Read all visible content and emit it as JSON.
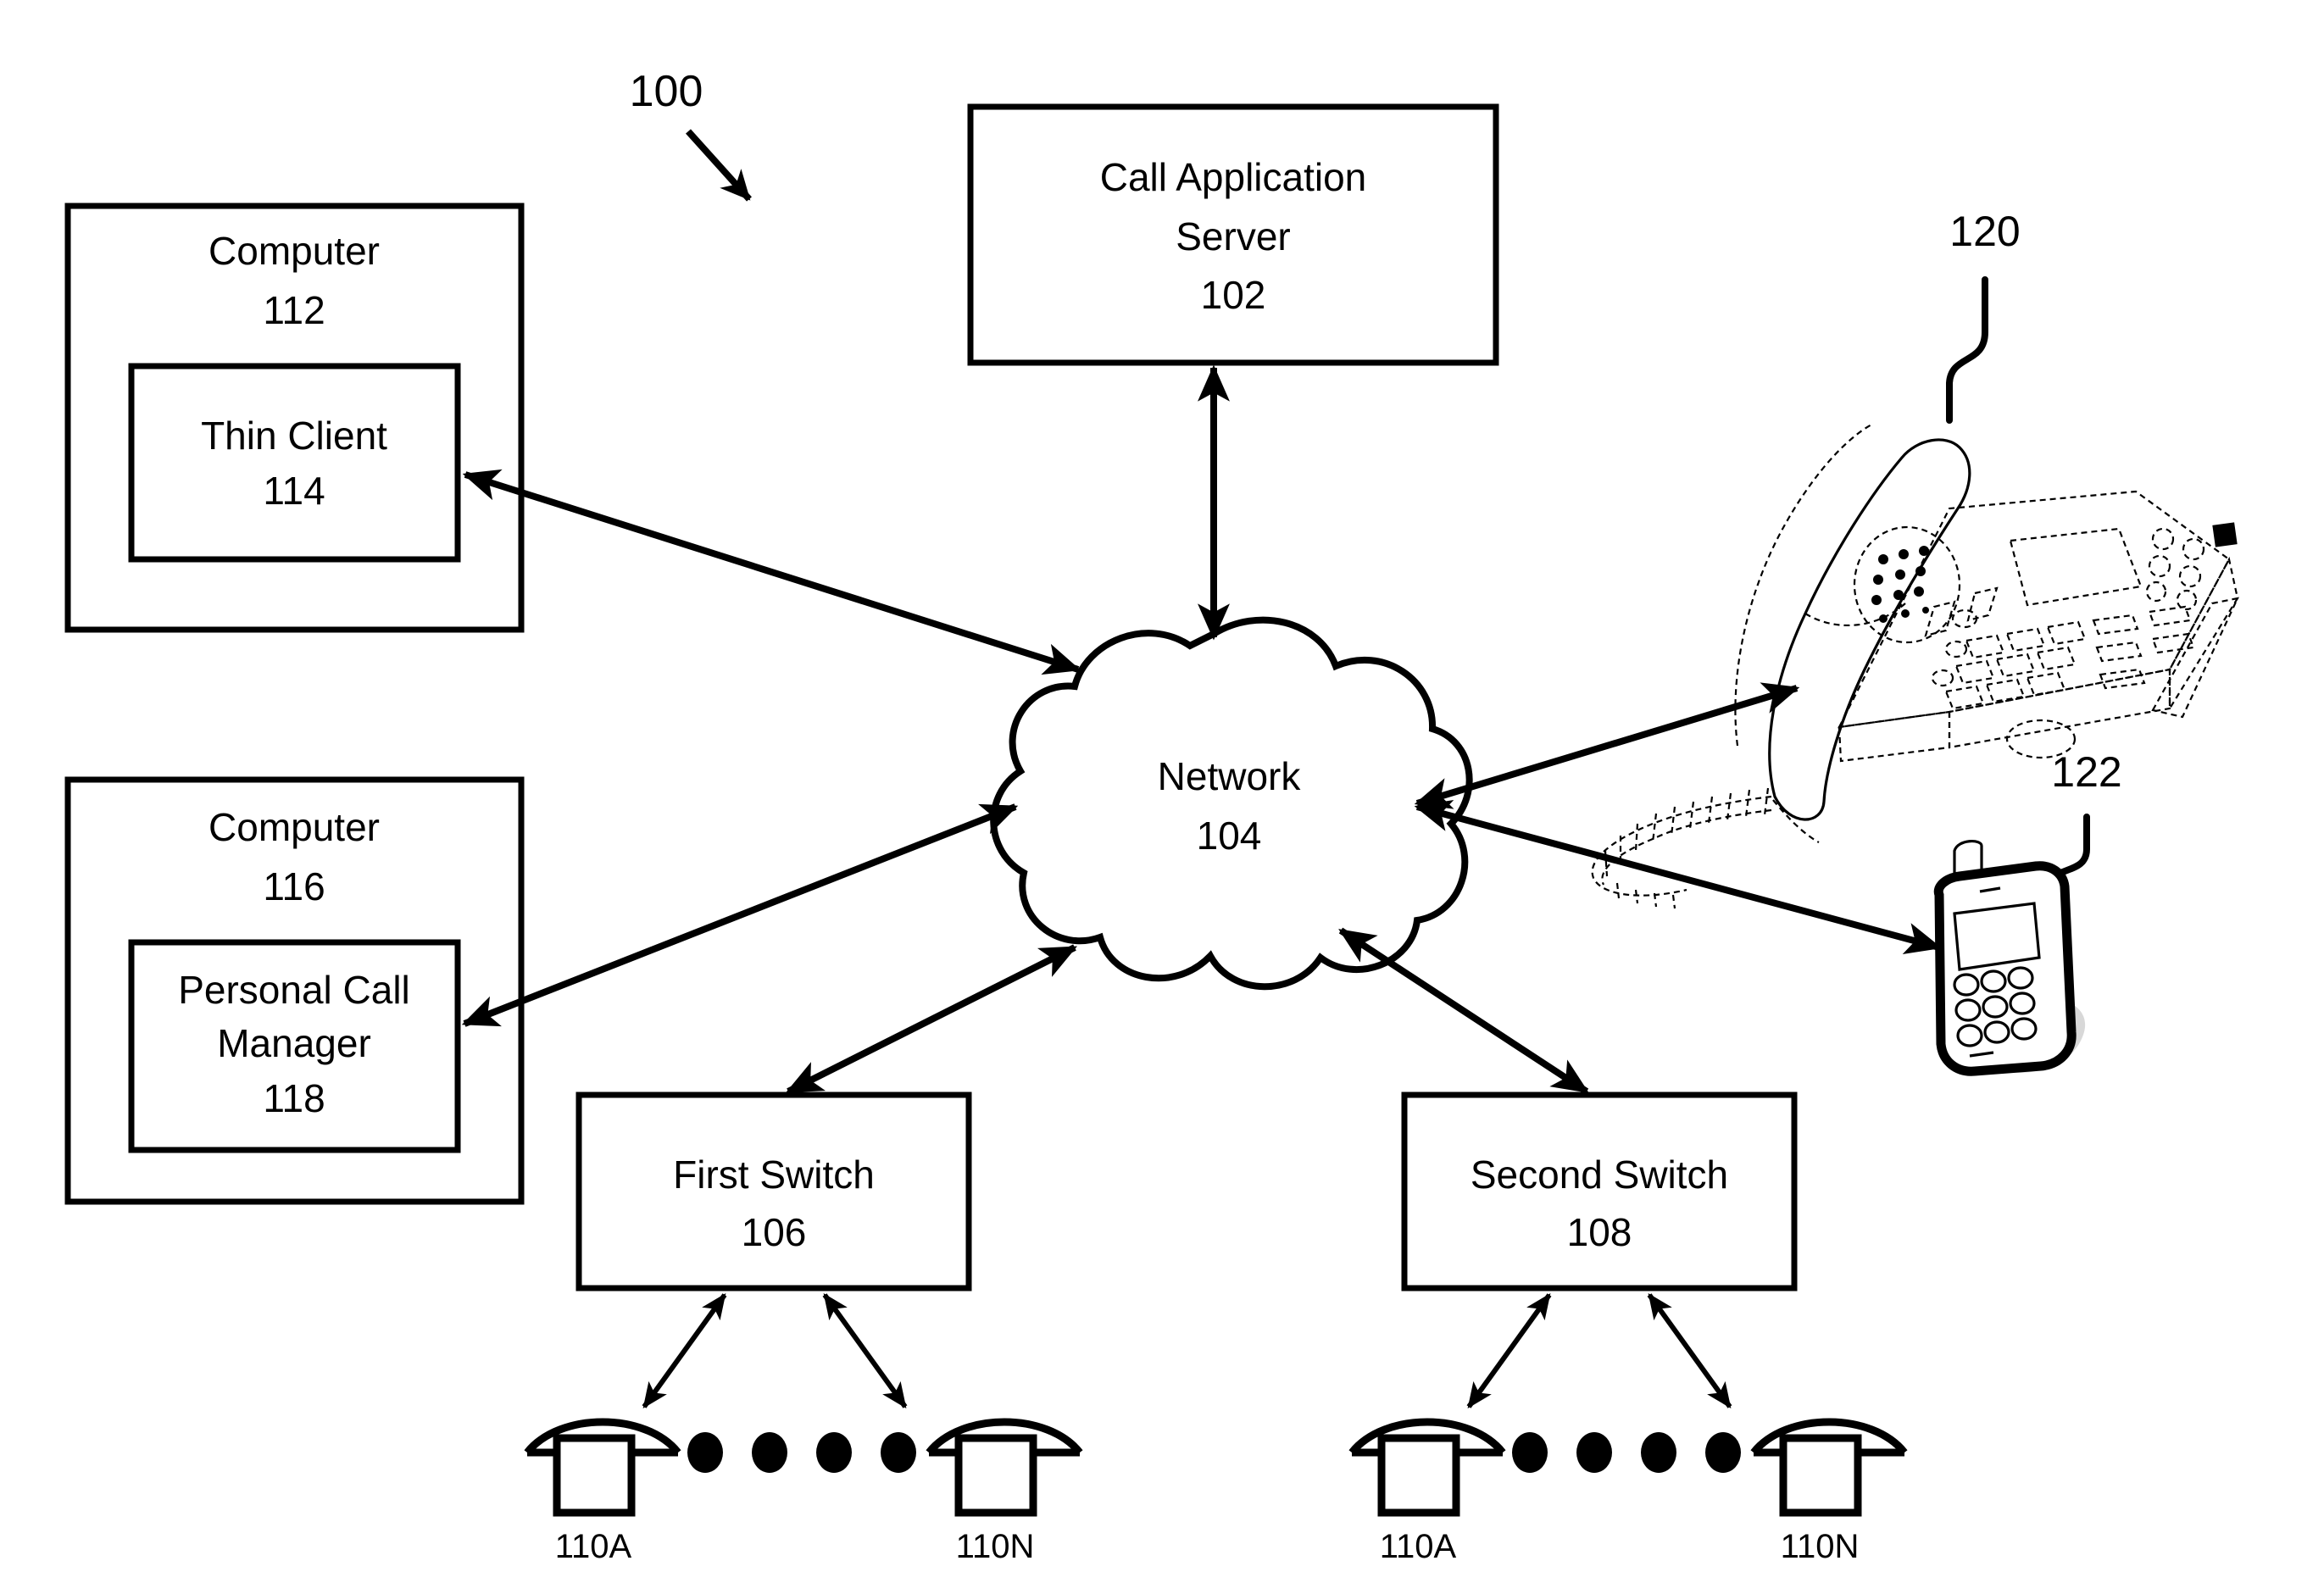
{
  "figure": {
    "figure_number": "100",
    "nodes": {
      "call_application_server": {
        "title_line1": "Call Application",
        "title_line2": "Server",
        "ref": "102"
      },
      "network": {
        "title": "Network",
        "ref": "104"
      },
      "first_switch": {
        "title": "First Switch",
        "ref": "106"
      },
      "second_switch": {
        "title": "Second Switch",
        "ref": "108"
      },
      "computer_112": {
        "title": "Computer",
        "ref": "112"
      },
      "thin_client": {
        "title": "Thin Client",
        "ref": "114"
      },
      "computer_116": {
        "title": "Computer",
        "ref": "116"
      },
      "personal_call_manager": {
        "title_line1": "Personal Call",
        "title_line2": "Manager",
        "ref": "118"
      },
      "desk_phone": {
        "ref": "120",
        "icon": "desk-phone-illustration"
      },
      "mobile_phone": {
        "ref": "122",
        "icon": "mobile-phone-illustration"
      }
    },
    "endpoint_groups": [
      {
        "group": "first-switch-endpoints",
        "first_label": "110A",
        "last_label": "110N",
        "ellipsis_dots": 4,
        "icon": "telephone-endpoint-icon"
      },
      {
        "group": "second-switch-endpoints",
        "first_label": "110A",
        "last_label": "110N",
        "ellipsis_dots": 4,
        "icon": "telephone-endpoint-icon"
      }
    ],
    "connections": [
      {
        "from": "call_application_server",
        "to": "network",
        "style": "double-arrow"
      },
      {
        "from": "thin_client",
        "to": "network",
        "style": "double-arrow"
      },
      {
        "from": "personal_call_manager",
        "to": "network",
        "style": "double-arrow"
      },
      {
        "from": "first_switch",
        "to": "network",
        "style": "double-arrow"
      },
      {
        "from": "second_switch",
        "to": "network",
        "style": "double-arrow"
      },
      {
        "from": "network",
        "to": "desk_phone",
        "style": "double-arrow"
      },
      {
        "from": "network",
        "to": "mobile_phone",
        "style": "double-arrow"
      },
      {
        "from": "first_switch",
        "to": "110A",
        "style": "double-arrow"
      },
      {
        "from": "first_switch",
        "to": "110N",
        "style": "double-arrow"
      },
      {
        "from": "second_switch",
        "to": "110A",
        "style": "double-arrow"
      },
      {
        "from": "second_switch",
        "to": "110N",
        "style": "double-arrow"
      }
    ],
    "colors": {
      "ink": "#000000",
      "paper": "#ffffff"
    }
  }
}
